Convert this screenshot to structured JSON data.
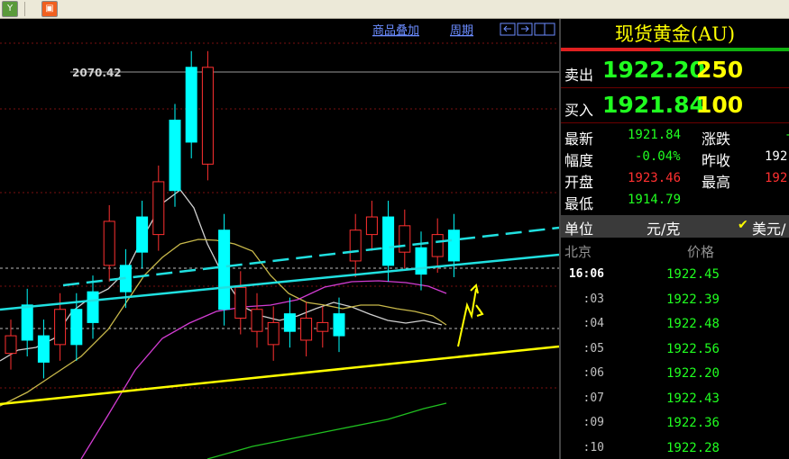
{
  "toolbar": {
    "button1_glyph": "Y",
    "button2_glyph": "▣"
  },
  "chart": {
    "links": {
      "overlay": "商品叠加",
      "period": "周期"
    },
    "max_label": "2070.42",
    "view_icons": [
      "tile-left-icon",
      "tile-right-icon",
      "fullscreen-icon"
    ],
    "colors": {
      "up": "#ff3030",
      "down": "#00ffff",
      "trend_cyan": "#20e0e0",
      "trend_yellow": "#ffff00"
    },
    "candles": [
      [
        1,
        1,
        0.72,
        0.76
      ],
      [
        0,
        1,
        0.65,
        0.73
      ],
      [
        0,
        1,
        0.72,
        0.78
      ],
      [
        1,
        1,
        0.66,
        0.74
      ],
      [
        0,
        1,
        0.66,
        0.74
      ],
      [
        0,
        1,
        0.62,
        0.69
      ],
      [
        1,
        1,
        0.46,
        0.56
      ],
      [
        0,
        1,
        0.56,
        0.62
      ],
      [
        0,
        1,
        0.45,
        0.53
      ],
      [
        1,
        1,
        0.37,
        0.49
      ],
      [
        0,
        1,
        0.23,
        0.39
      ],
      [
        0,
        1,
        0.11,
        0.28
      ],
      [
        1,
        1,
        0.11,
        0.33
      ],
      [
        0,
        1,
        0.48,
        0.66
      ],
      [
        1,
        1,
        0.61,
        0.68
      ],
      [
        1,
        1,
        0.66,
        0.71
      ],
      [
        1,
        1,
        0.69,
        0.74
      ],
      [
        0,
        1,
        0.67,
        0.71
      ],
      [
        1,
        1,
        0.68,
        0.73
      ],
      [
        1,
        1,
        0.69,
        0.71
      ],
      [
        0,
        1,
        0.67,
        0.72
      ],
      [
        1,
        1,
        0.48,
        0.55
      ],
      [
        1,
        1,
        0.45,
        0.49
      ],
      [
        0,
        1,
        0.45,
        0.56
      ],
      [
        1,
        1,
        0.47,
        0.53
      ],
      [
        0,
        1,
        0.52,
        0.58
      ],
      [
        1,
        1,
        0.49,
        0.54
      ],
      [
        0,
        1,
        0.48,
        0.55
      ]
    ]
  },
  "panel": {
    "title": "现货黄金(AU)",
    "sell": {
      "label": "卖出",
      "price": "1922.20",
      "volume": "250"
    },
    "buy": {
      "label": "买入",
      "price": "1921.84",
      "volume": "100"
    },
    "stats": {
      "latest_label": "最新",
      "latest": "1921.84",
      "change_label": "涨跌",
      "change": "-",
      "amplitude_label": "幅度",
      "amplitude": "-0.04%",
      "prev_close_label": "昨收",
      "prev_close": "192",
      "open_label": "开盘",
      "open": "1923.46",
      "high_label": "最高",
      "high": "192",
      "low_label": "最低",
      "low": "1914.79"
    },
    "unit": {
      "label": "单位",
      "value": "元/克",
      "currency": "美元/"
    },
    "ticks_header": {
      "city": "北京",
      "price": "价格"
    },
    "ticks": [
      {
        "time": "16:06",
        "price": "1922.45"
      },
      {
        "time": ":03",
        "price": "1922.39"
      },
      {
        "time": ":04",
        "price": "1922.48"
      },
      {
        "time": ":05",
        "price": "1922.56"
      },
      {
        "time": ":06",
        "price": "1922.20"
      },
      {
        "time": ":07",
        "price": "1922.43"
      },
      {
        "time": ":09",
        "price": "1922.36"
      },
      {
        "time": ":10",
        "price": "1922.28"
      }
    ]
  }
}
